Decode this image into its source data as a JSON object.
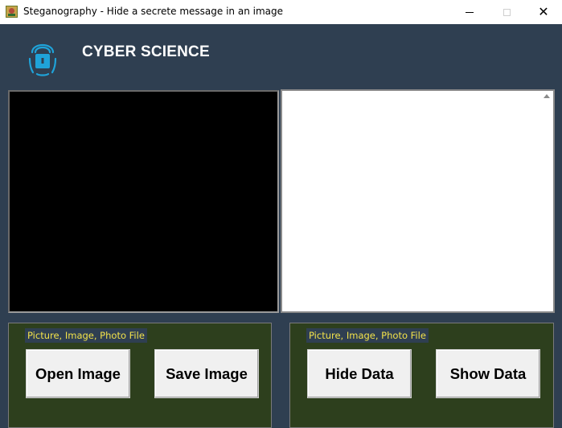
{
  "window": {
    "title": "Steganography - Hide a secrete message in an image",
    "icon": "app-picture-icon",
    "controls": [
      "minimize-icon",
      "maximize-icon",
      "close-icon"
    ],
    "close_glyph": "✕"
  },
  "header": {
    "logo_icon": "fingerprint-lock-icon",
    "brand": "CYBER SCIENCE"
  },
  "image_panel": {
    "background": "#000000"
  },
  "text_panel": {
    "value": ""
  },
  "left_group": {
    "label": "Picture, Image, Photo File",
    "buttons": {
      "open": "Open Image",
      "save": "Save Image"
    }
  },
  "right_group": {
    "label": "Picture, Image, Photo File",
    "buttons": {
      "hide": "Hide Data",
      "show": "Show Data"
    }
  },
  "colors": {
    "background": "#2f3f51",
    "group_background": "#2d3f1d",
    "label_text": "#f2e24a",
    "logo": "#1fa3d9"
  }
}
